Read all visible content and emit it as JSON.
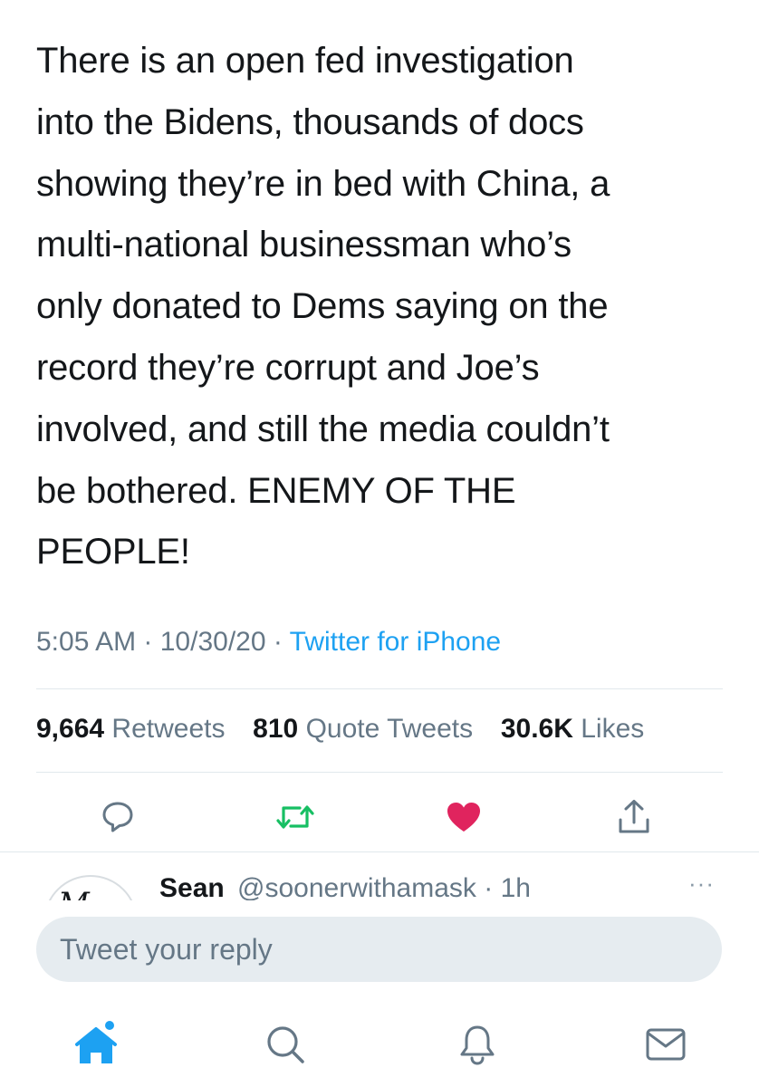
{
  "tweet": {
    "text_lines": [
      "There is an open fed investigation",
      "into the Bidens, thousands of docs",
      "showing they’re in bed with China, a",
      "multi-national businessman who’s",
      "only donated to Dems saying on the",
      "record they’re corrupt and Joe’s",
      "involved, and still the media couldn’t",
      "be bothered. ENEMY OF THE",
      "PEOPLE!"
    ],
    "time": "5:05 AM",
    "date": "10/30/20",
    "separator": "·",
    "source": "Twitter for iPhone"
  },
  "stats": {
    "retweets_count": "9,664",
    "retweets_label": "Retweets",
    "quotes_count": "810",
    "quotes_label": "Quote Tweets",
    "likes_count": "30.6K",
    "likes_label": "Likes"
  },
  "actions": {
    "reply_icon": "comment-icon",
    "retweet_icon": "retweet-icon",
    "like_icon": "heart-icon",
    "share_icon": "share-icon",
    "like_color": "#e0245e",
    "retweet_color": "#17bf63",
    "icon_color": "#657786"
  },
  "reply": {
    "name": "Sean",
    "handle": "@soonerwithamask",
    "separator": "·",
    "age": "1h",
    "more": "···",
    "avatar_mark": "M"
  },
  "composer": {
    "placeholder": "Tweet your reply"
  },
  "tabbar": {
    "items": [
      "home-icon",
      "search-icon",
      "notifications-icon",
      "messages-icon"
    ],
    "active": "home-icon",
    "accent": "#1da1f2"
  }
}
